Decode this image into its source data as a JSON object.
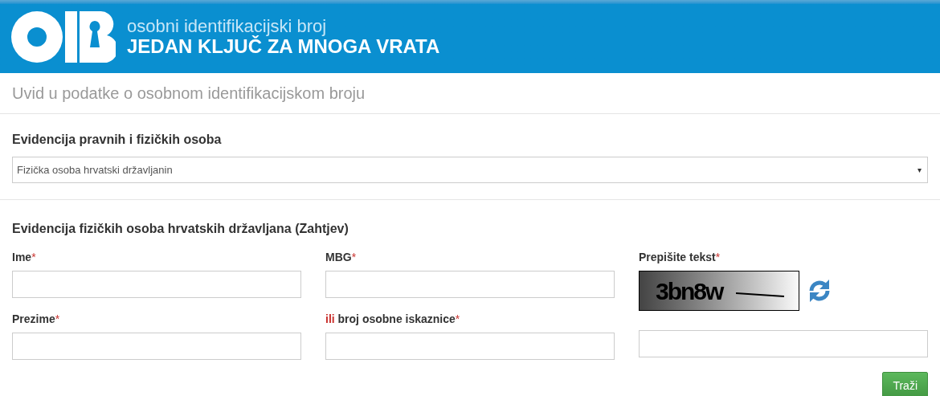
{
  "header": {
    "subtitle": "osobni identifikacijski broj",
    "title": "JEDAN KLJUČ ZA MNOGA VRATA"
  },
  "page_title": "Uvid u podatke o osobnom identifikacijskom broju",
  "registry": {
    "label": "Evidencija pravnih i fizičkih osoba",
    "value": "Fizička osoba hrvatski državljanin",
    "arrow": "▾"
  },
  "form": {
    "title": "Evidencija fizičkih osoba hrvatskih državljana (Zahtjev)",
    "fields": [
      {
        "label": "Ime",
        "required_mark": "*"
      },
      {
        "label": "MBG",
        "required_mark": "*"
      },
      {
        "label": "Prezime",
        "required_mark": "*"
      },
      {
        "prefix": "ili",
        "label": "broj osobne iskaznice",
        "required_mark": "*"
      }
    ],
    "captcha": {
      "label": "Prepišite tekst",
      "required_mark": "*",
      "text": "3bn8w"
    },
    "submit": "Traži"
  }
}
